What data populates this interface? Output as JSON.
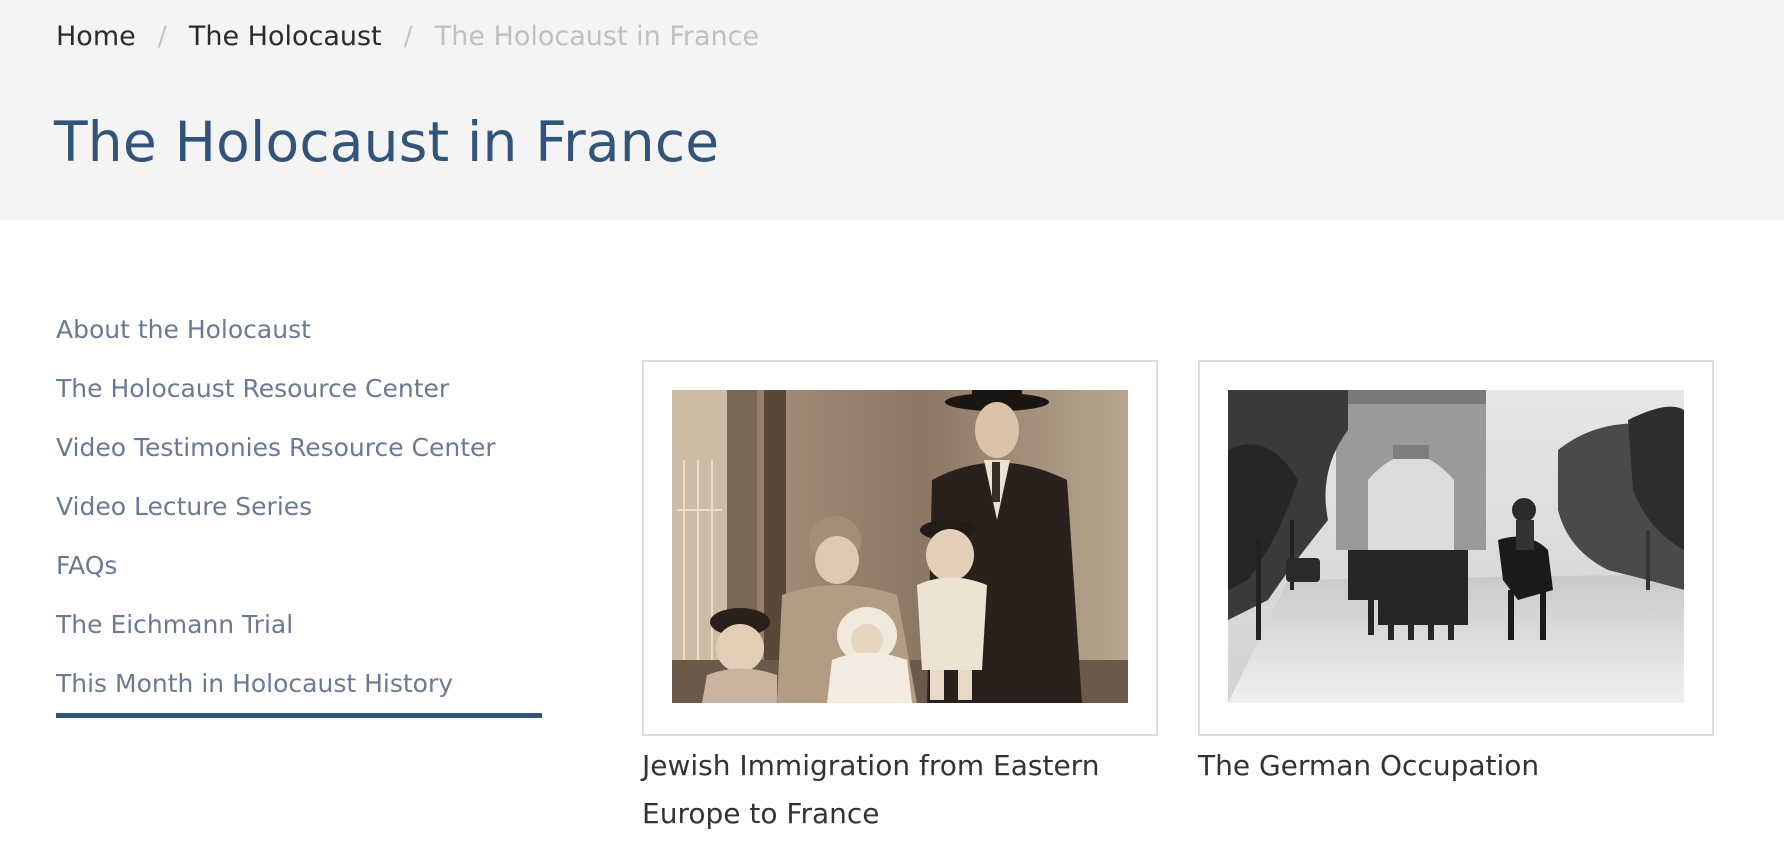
{
  "breadcrumb": {
    "items": [
      "Home",
      "The Holocaust"
    ],
    "separator": "/",
    "current": "The Holocaust in France"
  },
  "page": {
    "title": "The Holocaust in France"
  },
  "sidebar": {
    "items": [
      {
        "label": "About the Holocaust"
      },
      {
        "label": "The Holocaust Resource Center"
      },
      {
        "label": "Video Testimonies Resource Center"
      },
      {
        "label": "Video Lecture Series"
      },
      {
        "label": "FAQs"
      },
      {
        "label": "The Eichmann Trial"
      },
      {
        "label": "This Month in Holocaust History"
      }
    ],
    "active_index": 6
  },
  "cards": [
    {
      "caption": "Jewish Immigration from Eastern Europe to France"
    },
    {
      "caption": "The German Occupation"
    }
  ],
  "colors": {
    "accent": "#33547a",
    "header_bg": "#f4f4f4",
    "nav_text": "#6a7a95"
  }
}
